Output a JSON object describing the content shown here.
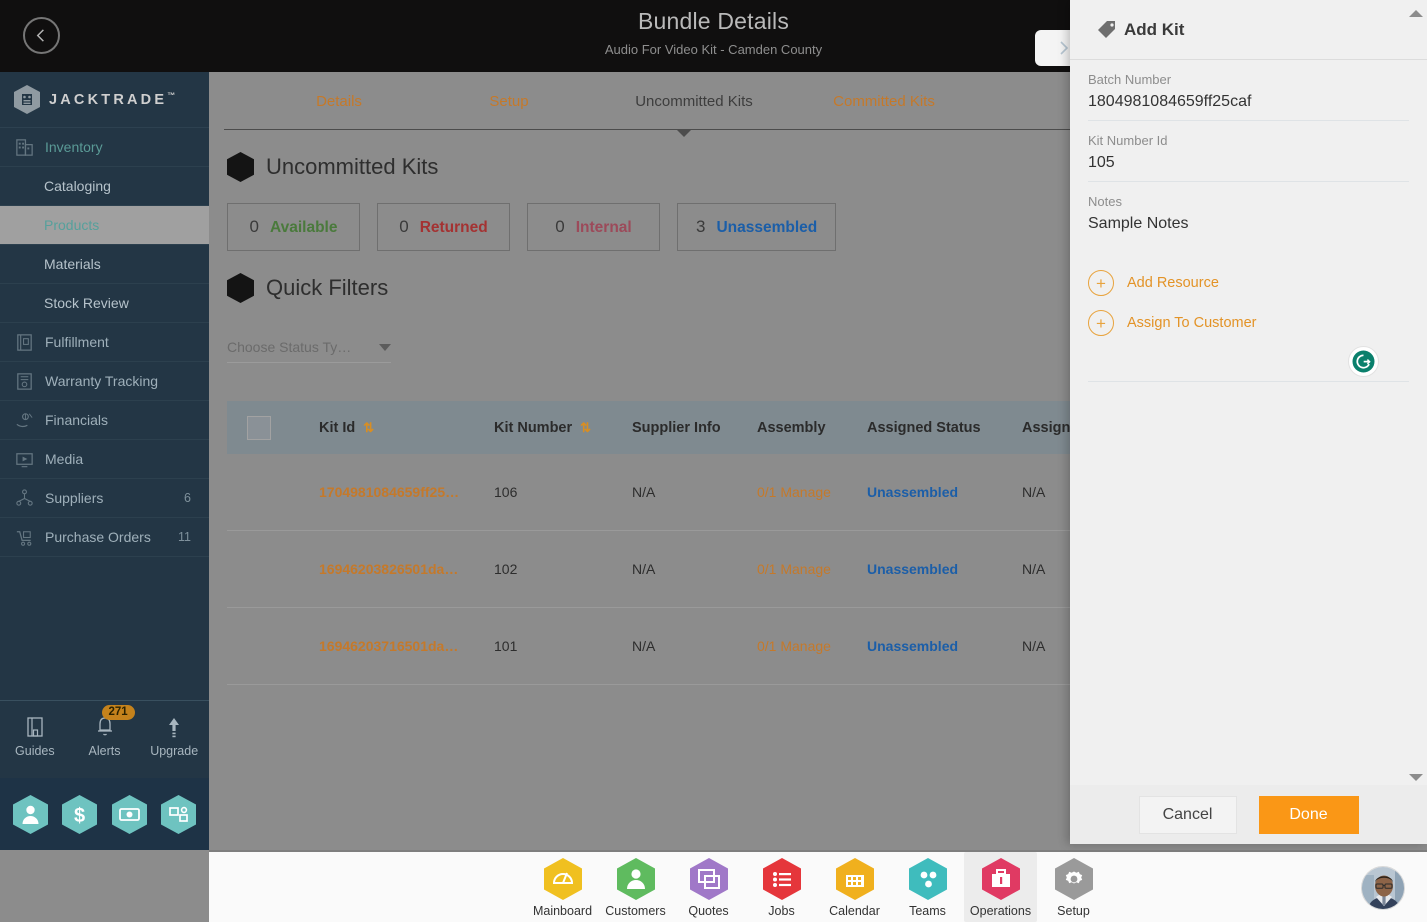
{
  "header": {
    "title": "Bundle Details",
    "subtitle": "Audio For Video Kit - Camden County",
    "back_icon": "chevron-left-icon",
    "next_icon": "chevron-right-icon"
  },
  "sidebar": {
    "brand": "JACKTRADE",
    "brand_tm": "™",
    "items": [
      {
        "label": "Inventory",
        "icon": "inventory-icon",
        "count": "",
        "type": "group"
      },
      {
        "label": "Cataloging",
        "icon": "",
        "count": "",
        "type": "sub"
      },
      {
        "label": "Products",
        "icon": "",
        "count": "",
        "type": "sub-active"
      },
      {
        "label": "Materials",
        "icon": "",
        "count": "",
        "type": "sub"
      },
      {
        "label": "Stock Review",
        "icon": "",
        "count": "",
        "type": "sub"
      },
      {
        "label": "Fulfillment",
        "icon": "fulfillment-icon",
        "count": "",
        "type": "item"
      },
      {
        "label": "Warranty Tracking",
        "icon": "warranty-icon",
        "count": "",
        "type": "item"
      },
      {
        "label": "Financials",
        "icon": "financials-icon",
        "count": "",
        "type": "item"
      },
      {
        "label": "Media",
        "icon": "media-icon",
        "count": "",
        "type": "item"
      },
      {
        "label": "Suppliers",
        "icon": "suppliers-icon",
        "count": "6",
        "type": "item"
      },
      {
        "label": "Purchase Orders",
        "icon": "purchase-icon",
        "count": "11",
        "type": "item"
      }
    ],
    "utility": [
      {
        "label": "Guides",
        "icon": "book-icon",
        "badge": ""
      },
      {
        "label": "Alerts",
        "icon": "bell-icon",
        "badge": "271"
      },
      {
        "label": "Upgrade",
        "icon": "arrow-up-icon",
        "badge": ""
      }
    ],
    "quick_icons": [
      "user-hex-icon",
      "dollar-hex-icon",
      "payment-hex-icon",
      "workflow-hex-icon"
    ]
  },
  "tabs": [
    {
      "label": "Details",
      "active": false
    },
    {
      "label": "Setup",
      "active": false
    },
    {
      "label": "Uncommitted Kits",
      "active": true
    },
    {
      "label": "Committed Kits",
      "active": false
    }
  ],
  "section": {
    "kits_title": "Uncommitted Kits",
    "quick_filters_title": "Quick Filters"
  },
  "stats": [
    {
      "count": "0",
      "label": "Available",
      "color": "#4a7a3c"
    },
    {
      "count": "0",
      "label": "Returned",
      "color": "#a43232"
    },
    {
      "count": "0",
      "label": "Internal",
      "color": "#9c4a5a"
    },
    {
      "count": "3",
      "label": "Unassembled",
      "color": "#1b5ea8"
    }
  ],
  "quick_filter": {
    "placeholder": "Choose Status Ty…",
    "caret_icon": "chevron-down-icon"
  },
  "table": {
    "columns": [
      {
        "label": "",
        "sortable": false
      },
      {
        "label": "Kit Id",
        "sortable": true
      },
      {
        "label": "Kit Number",
        "sortable": true
      },
      {
        "label": "Supplier Info",
        "sortable": false
      },
      {
        "label": "Assembly",
        "sortable": false
      },
      {
        "label": "Assigned Status",
        "sortable": false
      },
      {
        "label": "Assign",
        "sortable": false
      }
    ],
    "sort_icon": "sort-icon",
    "rows": [
      {
        "kit_id": "1704981084659ff25…",
        "kit_number": "106",
        "supplier_info": "N/A",
        "assembly": "0/1 Manage",
        "assigned_status": "Unassembled",
        "assign": "N/A"
      },
      {
        "kit_id": "16946203826501da…",
        "kit_number": "102",
        "supplier_info": "N/A",
        "assembly": "0/1 Manage",
        "assigned_status": "Unassembled",
        "assign": "N/A"
      },
      {
        "kit_id": "16946203716501da…",
        "kit_number": "101",
        "supplier_info": "N/A",
        "assembly": "0/1 Manage",
        "assigned_status": "Unassembled",
        "assign": "N/A"
      }
    ]
  },
  "bottom_nav": {
    "items": [
      {
        "label": "Mainboard",
        "icon": "mainboard-icon",
        "color": "#f0c020",
        "active": false
      },
      {
        "label": "Customers",
        "icon": "customers-icon",
        "color": "#5fbb5f",
        "active": false
      },
      {
        "label": "Quotes",
        "icon": "quotes-icon",
        "color": "#a078c8",
        "active": false
      },
      {
        "label": "Jobs",
        "icon": "jobs-icon",
        "color": "#e5363b",
        "active": false
      },
      {
        "label": "Calendar",
        "icon": "calendar-icon",
        "color": "#f0b01e",
        "active": false
      },
      {
        "label": "Teams",
        "icon": "teams-icon",
        "color": "#3fbcbd",
        "active": false
      },
      {
        "label": "Operations",
        "icon": "operations-icon",
        "color": "#e03a63",
        "active": true
      },
      {
        "label": "Setup",
        "icon": "setup-icon",
        "color": "#9a9a9a",
        "active": false
      }
    ],
    "avatar": "user-avatar"
  },
  "panel": {
    "title": "Add Kit",
    "title_icon": "tag-icon",
    "fields": [
      {
        "label": "Batch Number",
        "value": "1804981084659ff25caf"
      },
      {
        "label": "Kit Number Id",
        "value": "105"
      },
      {
        "label": "Notes",
        "value": "Sample Notes"
      }
    ],
    "grammarly_icon": "grammarly-icon",
    "actions": [
      {
        "label": "Add Resource",
        "icon": "plus-circle-icon"
      },
      {
        "label": "Assign To Customer",
        "icon": "plus-circle-icon"
      }
    ],
    "cancel_label": "Cancel",
    "done_label": "Done",
    "scroll_up_icon": "scroll-up-icon",
    "scroll_down_icon": "scroll-down-icon"
  },
  "colors": {
    "accent_orange": "#e39327",
    "done_button": "#fa9716",
    "sidebar_bg": "#233645",
    "panel_bg": "#f0f0f0",
    "overlay": "#8c8c8c"
  }
}
